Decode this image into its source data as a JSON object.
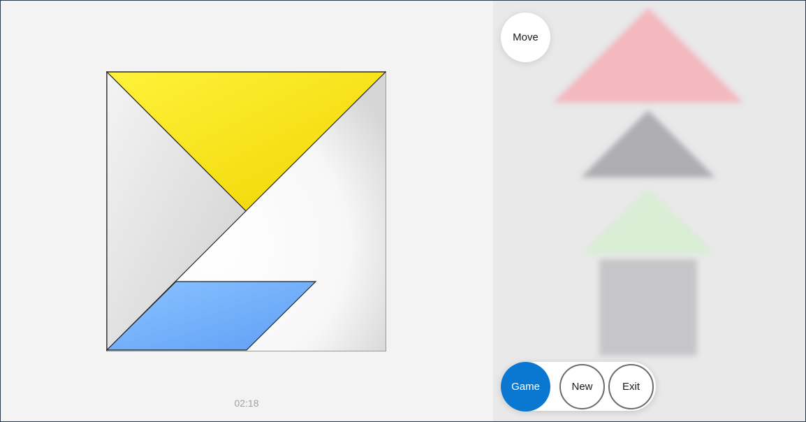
{
  "timer": {
    "elapsed": "02:18"
  },
  "controls": {
    "move_label": "Move",
    "game_label": "Game",
    "new_label": "New",
    "exit_label": "Exit"
  },
  "colors": {
    "accent": "#0a78d0",
    "yellow_piece": "#f7e21c",
    "white_piece": "#e2e2e2",
    "blue_piece": "#7ab6ff",
    "tray_pink": "#f4b8c0",
    "tray_gray": "#aeadb2",
    "tray_green": "#d8edd4",
    "tray_square": "#c6c6c9"
  },
  "board": {
    "pieces": [
      {
        "name": "yellow-large-triangle",
        "color": "yellow"
      },
      {
        "name": "white-large-triangle",
        "color": "white"
      },
      {
        "name": "blue-parallelogram",
        "color": "blue"
      }
    ]
  },
  "tray": {
    "pieces": [
      {
        "name": "pink-triangle",
        "color": "pink"
      },
      {
        "name": "gray-triangle",
        "color": "gray"
      },
      {
        "name": "green-triangle",
        "color": "green"
      },
      {
        "name": "gray-square",
        "color": "gray"
      }
    ]
  }
}
